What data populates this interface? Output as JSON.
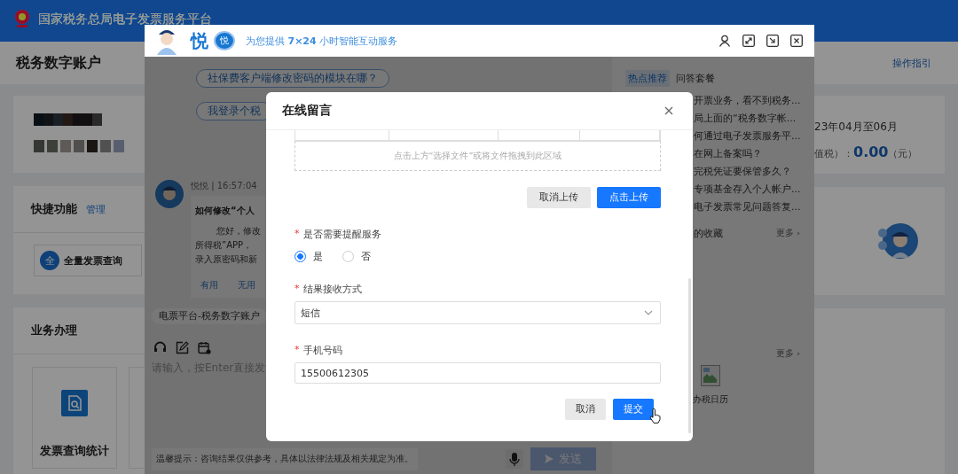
{
  "page": {
    "header_title": "国家税务总局电子发票服务平台",
    "title": "税务数字账户",
    "guide_link": "操作指引",
    "quick": {
      "title": "快捷功能",
      "manage_link": "管理",
      "items": [
        {
          "icon_char": "全",
          "label": "全量发票查询"
        }
      ]
    },
    "business": {
      "title": "业务办理",
      "items": [
        {
          "label": "发票查询统计"
        }
      ]
    },
    "summary": {
      "period": "23年04月至06月",
      "tax_label": "值税）：",
      "amount": "0.00",
      "unit": "（元）"
    }
  },
  "chat": {
    "brand": "悦",
    "badge_char": "悦",
    "tagline": "为您提供 **7×24** 小时智能互动服务",
    "suggestions": [
      "社保费客户端修改密码的模块在哪？",
      "我登录个税"
    ],
    "message": {
      "sender_time": "悦悦 | 16:57:04",
      "title": "如何修改“个人",
      "lines": [
        "您好，修改",
        "所得税”APP，",
        "录入原密码和新"
      ],
      "feedback": [
        "有用",
        "无用"
      ]
    },
    "context_chip": "电票平台-税务数字账户",
    "input": {
      "placeholder": "请输入，按Enter直接发"
    },
    "tip": "温馨提示：咨询结果仅供参考，具体以法律法规及相关规定为准。",
    "send": "发送",
    "tabs": [
      {
        "label": "热点推荐",
        "selected": true
      },
      {
        "label": "问答套餐",
        "selected": false
      }
    ],
    "hot_list": [
      "开票业务，看不到税务...",
      "局上面的“税务数字帐...",
      "何通过电子发票服务平...",
      "在网上备案吗？",
      "完税凭证要保管多久？",
      "专项基金存入个人帐户...",
      "电子发票常见问题答复..."
    ],
    "favorites_title": "的收藏",
    "more_links": [
      "更多 ›",
      "更多 ›"
    ],
    "calendar_label": "办税日历"
  },
  "modal": {
    "title": "在线留言",
    "drop_hint": "点击上方“选择文件”或将文件拖拽到此区域",
    "upload_buttons": [
      {
        "label": "取消上传",
        "kind": "default"
      },
      {
        "label": "点击上传",
        "kind": "primary"
      }
    ],
    "fields": [
      {
        "kind": "radio",
        "label": "是否需要提醒服务",
        "marker": "*",
        "options": [
          {
            "label": "是",
            "selected": true
          },
          {
            "label": "否",
            "selected": false
          }
        ]
      },
      {
        "kind": "select",
        "label": "结果接收方式",
        "marker": "*",
        "value": "短信"
      },
      {
        "kind": "input",
        "label": "手机号码",
        "marker": "*",
        "value": "15500612305"
      }
    ],
    "footer_buttons": [
      {
        "label": "取消",
        "kind": "default"
      },
      {
        "label": "提交",
        "kind": "primary"
      }
    ]
  }
}
